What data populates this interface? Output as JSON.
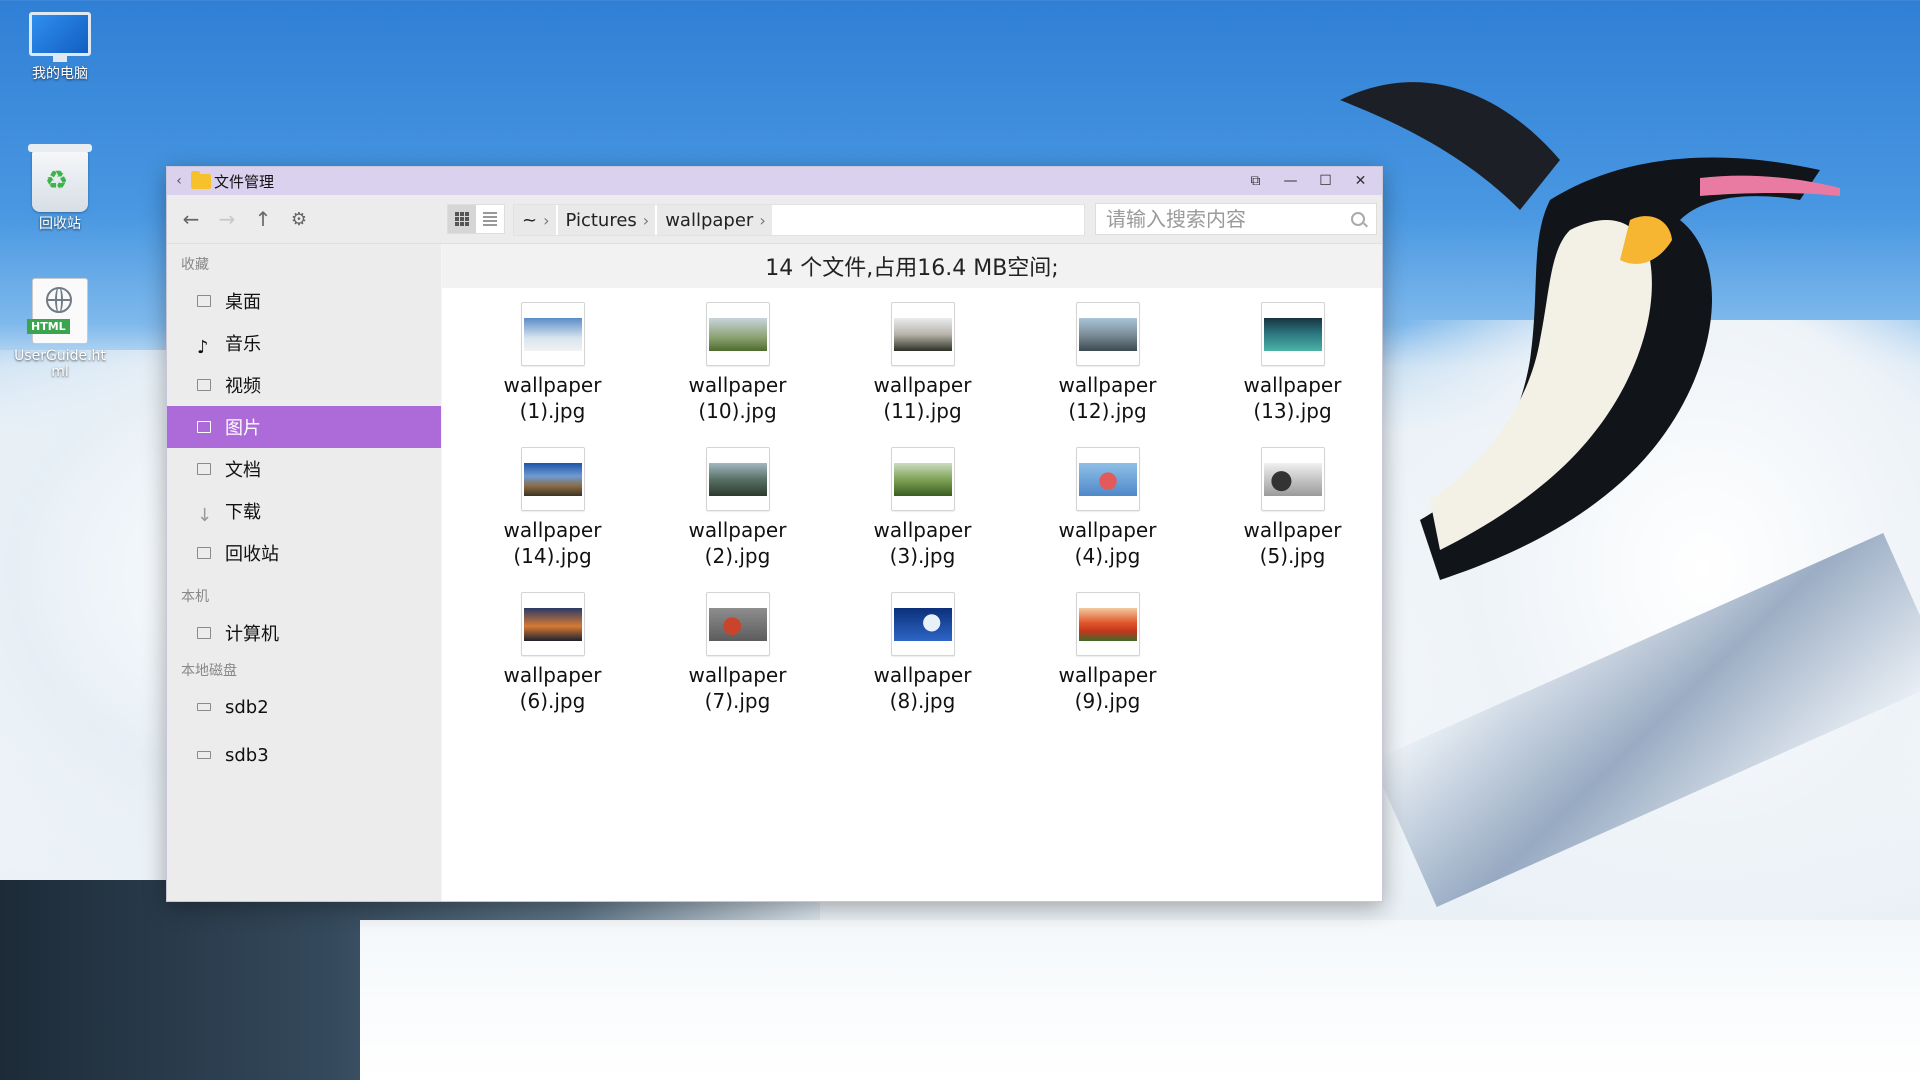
{
  "desktop": {
    "icons": [
      {
        "label": "我的电脑",
        "icon": "computer-icon"
      },
      {
        "label": "回收站",
        "icon": "recycle-bin-icon"
      },
      {
        "label": "UserGuide.html",
        "badge": "HTML",
        "icon": "html-file-icon"
      }
    ]
  },
  "window": {
    "title": "文件管理",
    "icons": {
      "back": "chevron-left-icon",
      "folder": "folder-icon"
    },
    "controls": [
      "pin-icon",
      "minimize-icon",
      "maximize-icon",
      "close-icon"
    ]
  },
  "toolbar": {
    "nav": [
      "back-arrow-icon",
      "forward-arrow-icon",
      "up-arrow-icon",
      "settings-gear-icon"
    ],
    "view_modes": [
      "grid-view",
      "list-view"
    ],
    "active_view": "grid-view",
    "breadcrumb": [
      "~",
      "Pictures",
      "wallpaper"
    ],
    "search_placeholder": "请输入搜索内容"
  },
  "sidebar": {
    "sections": [
      {
        "title": "收藏",
        "items": [
          "桌面",
          "音乐",
          "视频",
          "图片",
          "文档",
          "下载",
          "回收站"
        ]
      },
      {
        "title": "本机",
        "items": [
          "计算机"
        ]
      },
      {
        "title": "本地磁盘",
        "items": [
          "sdb2",
          "sdb3"
        ]
      }
    ],
    "active_item": "图片"
  },
  "content": {
    "summary": "14 个文件,占用16.4 MB空间;",
    "files": [
      {
        "line1": "wallpaper",
        "line2": "(1).jpg"
      },
      {
        "line1": "wallpaper",
        "line2": "(10).jpg"
      },
      {
        "line1": "wallpaper",
        "line2": "(11).jpg"
      },
      {
        "line1": "wallpaper",
        "line2": "(12).jpg"
      },
      {
        "line1": "wallpaper",
        "line2": "(13).jpg"
      },
      {
        "line1": "wallpaper",
        "line2": "(14).jpg"
      },
      {
        "line1": "wallpaper",
        "line2": "(2).jpg"
      },
      {
        "line1": "wallpaper",
        "line2": "(3).jpg"
      },
      {
        "line1": "wallpaper",
        "line2": "(4).jpg"
      },
      {
        "line1": "wallpaper",
        "line2": "(5).jpg"
      },
      {
        "line1": "wallpaper",
        "line2": "(6).jpg"
      },
      {
        "line1": "wallpaper",
        "line2": "(7).jpg"
      },
      {
        "line1": "wallpaper",
        "line2": "(8).jpg"
      },
      {
        "line1": "wallpaper",
        "line2": "(9).jpg"
      }
    ]
  },
  "colors": {
    "accent": "#ac6bd9",
    "titlebar": "#d9d1ee"
  }
}
